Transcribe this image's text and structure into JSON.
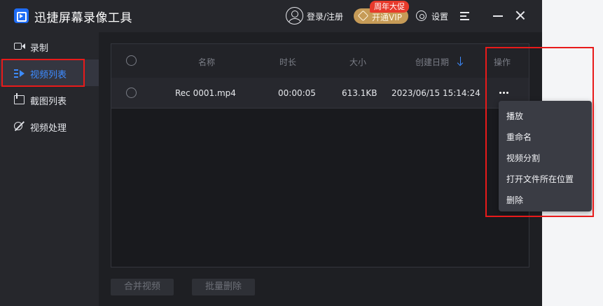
{
  "app": {
    "title": "迅捷屏幕录像工具",
    "login_label": "登录/注册",
    "vip_label": "开通VIP",
    "promo_badge": "周年大促",
    "settings_label": "设置"
  },
  "sidebar": {
    "items": [
      {
        "label": "录制",
        "icon": "record-icon",
        "active": false
      },
      {
        "label": "视频列表",
        "icon": "video-list-icon",
        "active": true
      },
      {
        "label": "截图列表",
        "icon": "screenshot-list-icon",
        "active": false
      },
      {
        "label": "视频处理",
        "icon": "video-process-icon",
        "active": false
      }
    ]
  },
  "table": {
    "columns": [
      "名称",
      "时长",
      "大小",
      "创建日期",
      "操作"
    ],
    "sort_column": "创建日期",
    "rows": [
      {
        "name": "Rec 0001.mp4",
        "duration": "00:00:05",
        "size": "613.1KB",
        "created": "2023/06/15 15:14:24",
        "action_icon": "more-icon"
      }
    ]
  },
  "context_menu": {
    "items": [
      "播放",
      "重命名",
      "视频分割",
      "打开文件所在位置",
      "删除"
    ]
  },
  "footer": {
    "merge_label": "合并视频",
    "batch_delete_label": "批量删除"
  },
  "colors": {
    "accent": "#3d8bff",
    "vip_gold": "#c69b57",
    "promo_red": "#e83a2c",
    "highlight_red": "#e81a1a",
    "background": "#1e1f23"
  }
}
